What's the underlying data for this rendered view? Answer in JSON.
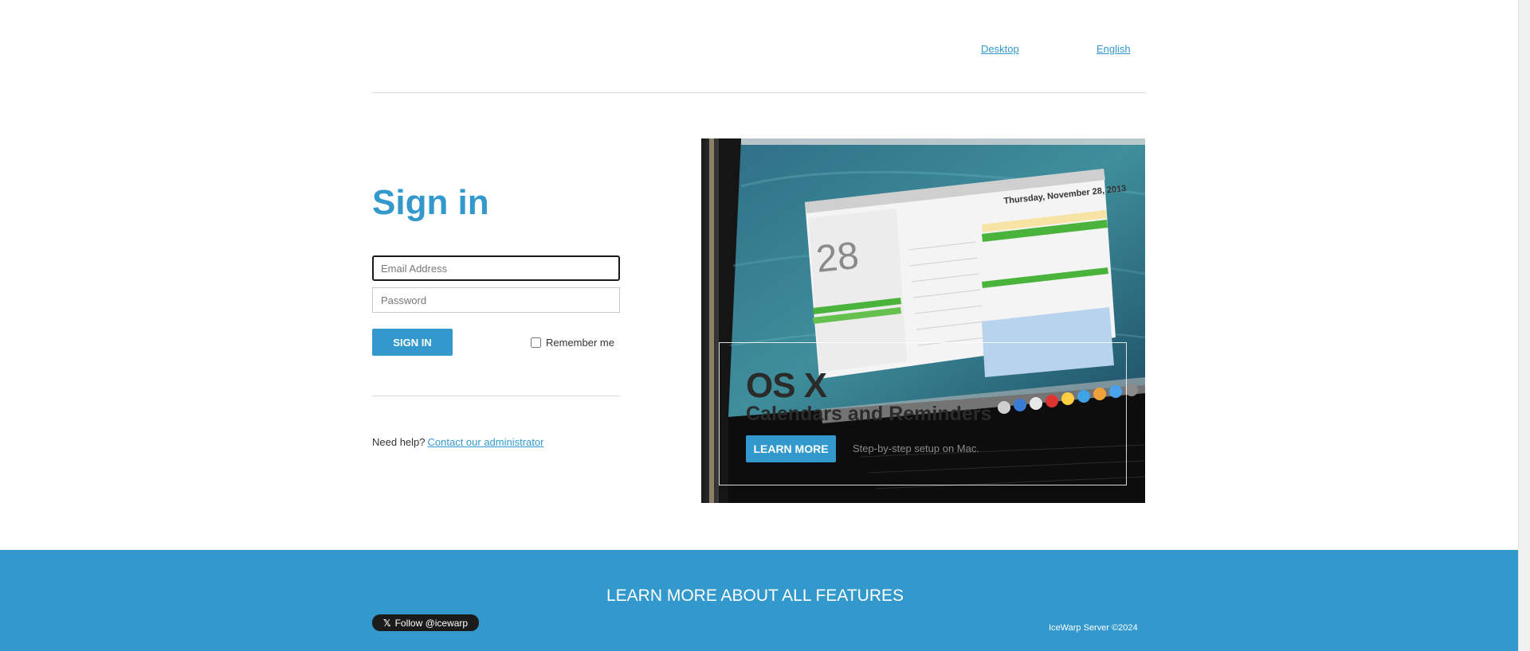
{
  "header": {
    "desktop_link": "Desktop",
    "language_link": "English"
  },
  "signin": {
    "title": "Sign in",
    "email_placeholder": "Email Address",
    "email_value": "",
    "password_placeholder": "Password",
    "password_value": "",
    "submit_label": "SIGN IN",
    "remember_label": "Remember me",
    "remember_checked": false,
    "help_text": "Need help?",
    "help_link": "Contact our administrator"
  },
  "promo": {
    "title": "OS X",
    "subtitle": "Calendars and Reminders",
    "button_label": "LEARN MORE",
    "caption": "Step-by-step setup on Mac.",
    "image_icon": "mac-calendar-screenshot",
    "calendar_date_text": "Thursday, November 28, 2013",
    "calendar_day_number": "28"
  },
  "footer": {
    "heading": "LEARN MORE ABOUT ALL FEATURES",
    "twitter_label": "Follow @icewarp",
    "twitter_icon": "x-icon",
    "copyright": "IceWarp Server ©2024"
  },
  "colors": {
    "accent": "#3399cc",
    "footer_bg": "#3399cc",
    "text": "#333333"
  }
}
